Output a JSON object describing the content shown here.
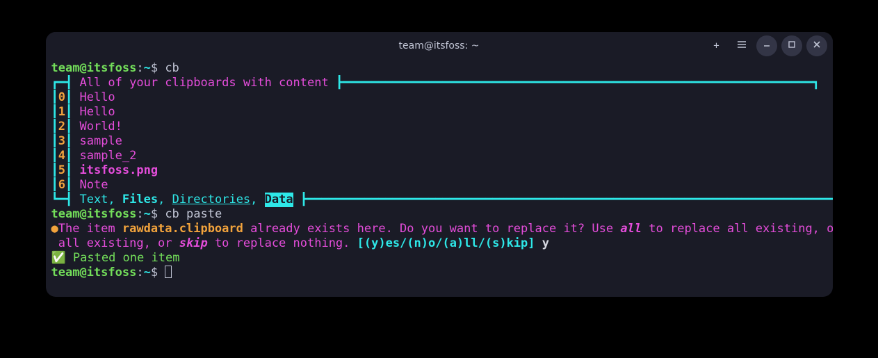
{
  "titlebar": {
    "title": "team@itsfoss: ~"
  },
  "colors": {
    "cyan": "#2ee8e8",
    "green": "#73de5a",
    "magenta": "#e54ddb",
    "orange": "#f2a33c",
    "bg": "#1a1b26",
    "fg": "#c0c4d4"
  },
  "prompt": {
    "userhost": "team@itsfoss",
    "path": "~",
    "symbol": "$"
  },
  "commands": {
    "c1": "cb",
    "c2": "cb paste",
    "reply": "y"
  },
  "box": {
    "header": "All of your clipboards with content",
    "items": [
      {
        "idx": "0",
        "label": "Hello"
      },
      {
        "idx": "1",
        "label": "Hello"
      },
      {
        "idx": "2",
        "label": "World!"
      },
      {
        "idx": "3",
        "label": "sample"
      },
      {
        "idx": "4",
        "label": "sample_2"
      },
      {
        "idx": "5",
        "label": "itsfoss.png"
      },
      {
        "idx": "6",
        "label": "Note"
      }
    ],
    "legend": {
      "text": "Text",
      "files": "Files",
      "dirs": "Directories",
      "data": "Data"
    }
  },
  "msg": {
    "item": "rawdata.clipboard",
    "exists1": "The item ",
    "exists2": " already exists here. Do you want to replace it? Use ",
    "all": "all",
    "exists3": " to replace all existing, or ",
    "skip": "skip",
    "exists4": " to replace nothing. ",
    "choices": "[(y)es/(n)o/(a)ll/(s)kip] ",
    "pasted": "Pasted one item"
  }
}
